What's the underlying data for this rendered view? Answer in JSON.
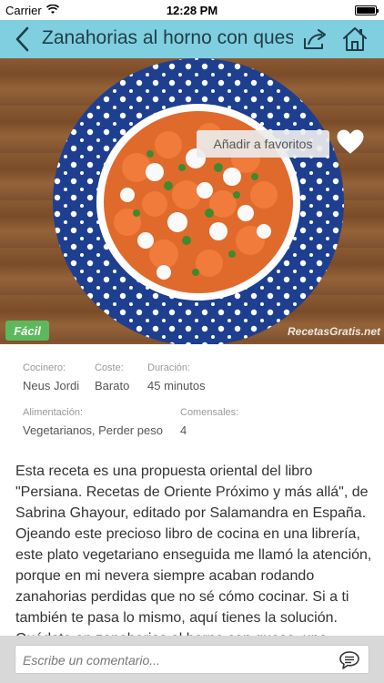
{
  "status_bar": {
    "carrier": "Carrier",
    "time": "12:28 PM",
    "battery_level": 1.0
  },
  "nav": {
    "title": "Zanahorias al horno con ques",
    "accent": "#7fcfe0"
  },
  "hero": {
    "favorite_label": "Añadir a favoritos",
    "difficulty": "Fácil",
    "watermark": "RecetasGratis.net"
  },
  "info": {
    "cook_label": "Cocinero:",
    "cook_value": "Neus Jordi",
    "cost_label": "Coste:",
    "cost_value": "Barato",
    "duration_label": "Duración:",
    "duration_value": "45 minutos",
    "diet_label": "Alimentación:",
    "diet_value": "Vegetarianos, Perder peso",
    "diners_label": "Comensales:",
    "diners_value": "4"
  },
  "description": "Esta receta es una propuesta oriental del libro \"Persiana. Recetas de Oriente Próximo y más allá\", de Sabrina Ghayour, editado por Salamandra en España. Ojeando este precioso libro de cocina en una librería, este plato vegetariano enseguida me llamó la atención, porque en mi nevera siempre acaban rodando zanahorias perdidas que no sé cómo cocinar. Si a ti también te pasa lo mismo, aquí tienes la solución. Quédate en zanahorias al horno con queso, una opción",
  "comment": {
    "placeholder": "Escribe un comentario..."
  },
  "icons": {
    "back": "back-chevron-icon",
    "share": "share-icon",
    "home": "home-icon",
    "favorite": "heart-icon",
    "comment": "chat-bubble-icon",
    "wifi": "wifi-icon"
  }
}
